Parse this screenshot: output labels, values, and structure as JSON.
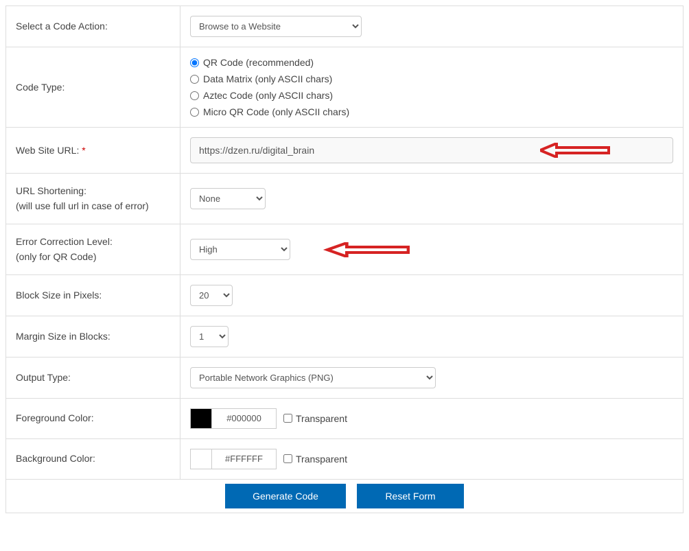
{
  "labels": {
    "code_action": "Select a Code Action:",
    "code_type": "Code Type:",
    "url": "Web Site URL:",
    "url_shortening": "URL Shortening:",
    "url_shortening_sub": "(will use full url in case of error)",
    "ecl": "Error Correction Level:",
    "ecl_sub": "(only for QR Code)",
    "block_size": "Block Size in Pixels:",
    "margin_size": "Margin Size in Blocks:",
    "output_type": "Output Type:",
    "fg_color": "Foreground Color:",
    "bg_color": "Background Color:",
    "transparent": "Transparent",
    "required": "*"
  },
  "code_action": {
    "selected": "Browse to a Website"
  },
  "code_type": {
    "options": [
      "QR Code (recommended)",
      "Data Matrix (only ASCII chars)",
      "Aztec Code (only ASCII chars)",
      "Micro QR Code (only ASCII chars)"
    ],
    "selected_index": 0
  },
  "url": {
    "value": "https://dzen.ru/digital_brain"
  },
  "url_shortening": {
    "selected": "None"
  },
  "ecl": {
    "selected": "High"
  },
  "block_size": {
    "selected": "20"
  },
  "margin_size": {
    "selected": "1"
  },
  "output_type": {
    "selected": "Portable Network Graphics (PNG)"
  },
  "fg_color": {
    "value": "#000000",
    "swatch": "#000000",
    "transparent": false
  },
  "bg_color": {
    "value": "#FFFFFF",
    "swatch": "#FFFFFF",
    "transparent": false
  },
  "buttons": {
    "generate": "Generate Code",
    "reset": "Reset Form"
  },
  "arrow_color": "#d62323"
}
